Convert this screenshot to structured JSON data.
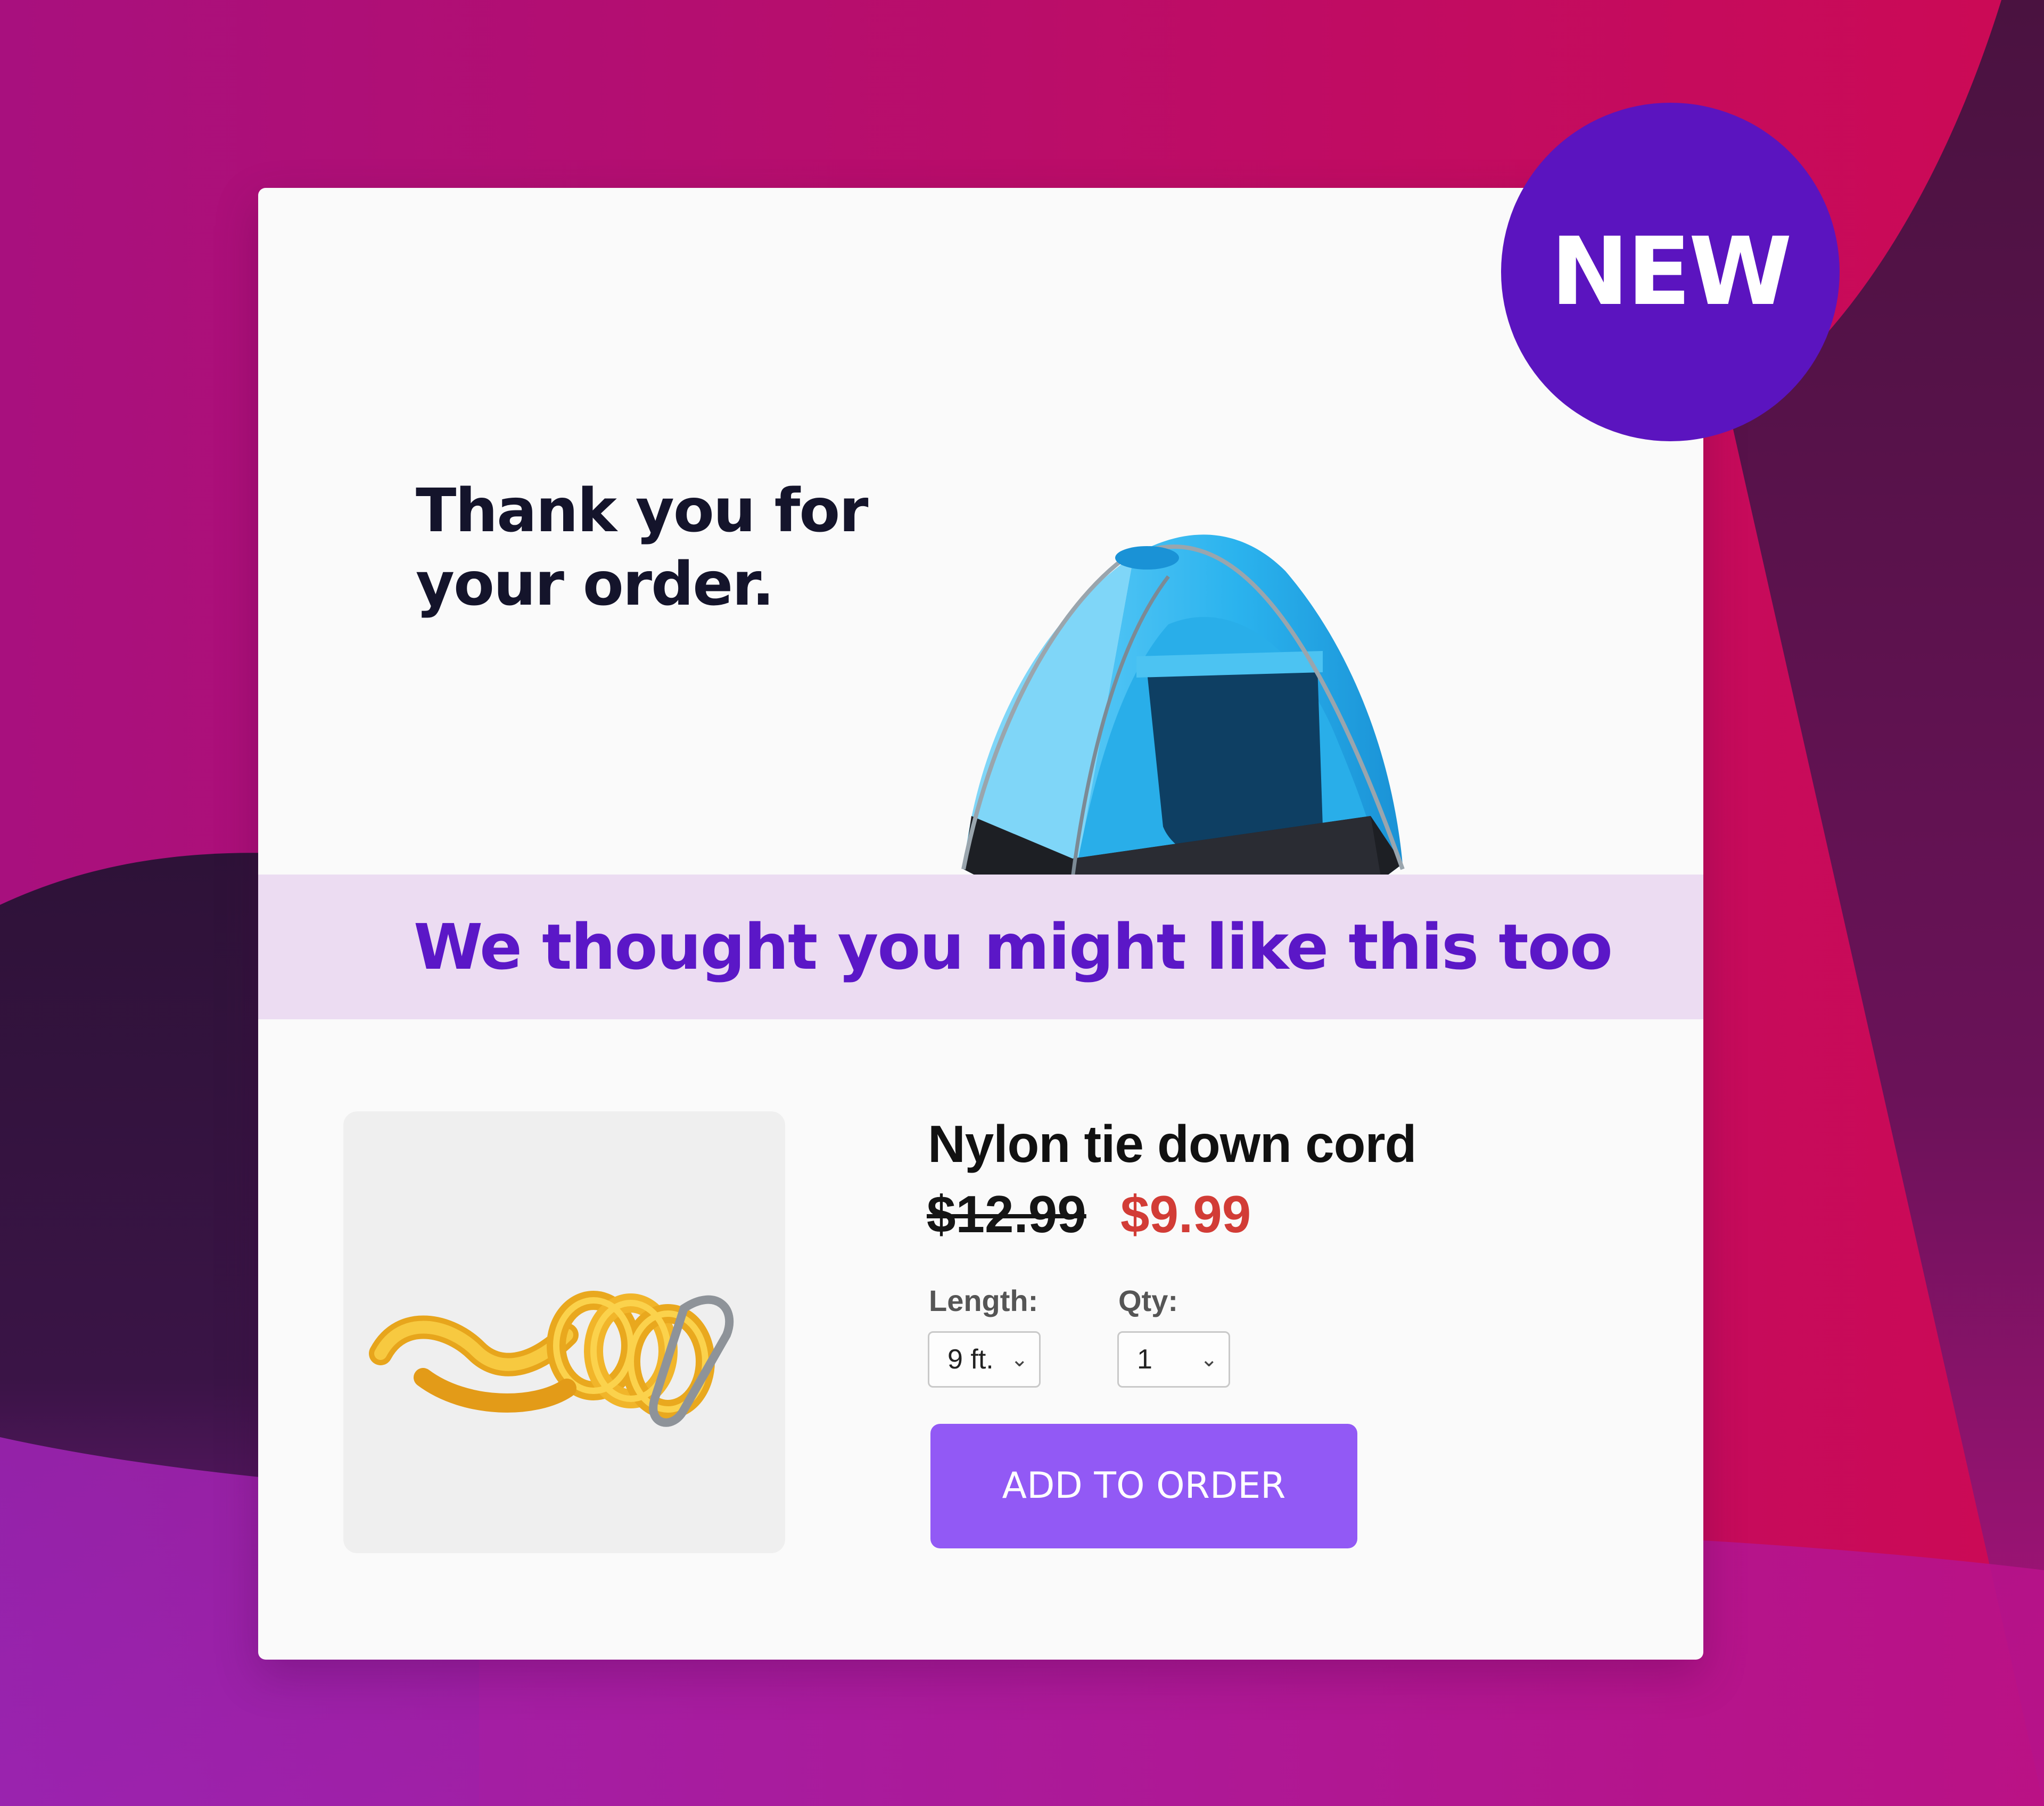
{
  "colors": {
    "brand_purple": "#5b14bf",
    "button_purple": "#9259f5",
    "banner_bg": "#ecdcf2",
    "sale_red": "#d23c36",
    "tent_blue": "#2bb3ee"
  },
  "badge": {
    "label": "NEW"
  },
  "hero": {
    "line1": "Thank you for",
    "line2": "your order.",
    "image_icon": "tent-icon"
  },
  "banner": {
    "text": "We thought you might like this too"
  },
  "product": {
    "image_icon": "rope-icon",
    "name": "Nylon tie down cord",
    "price_old": "$12.99",
    "price_new": "$9.99",
    "length_label": "Length:",
    "length_value": "9 ft.",
    "qty_label": "Qty:",
    "qty_value": "1",
    "add_button": "ADD TO ORDER"
  }
}
